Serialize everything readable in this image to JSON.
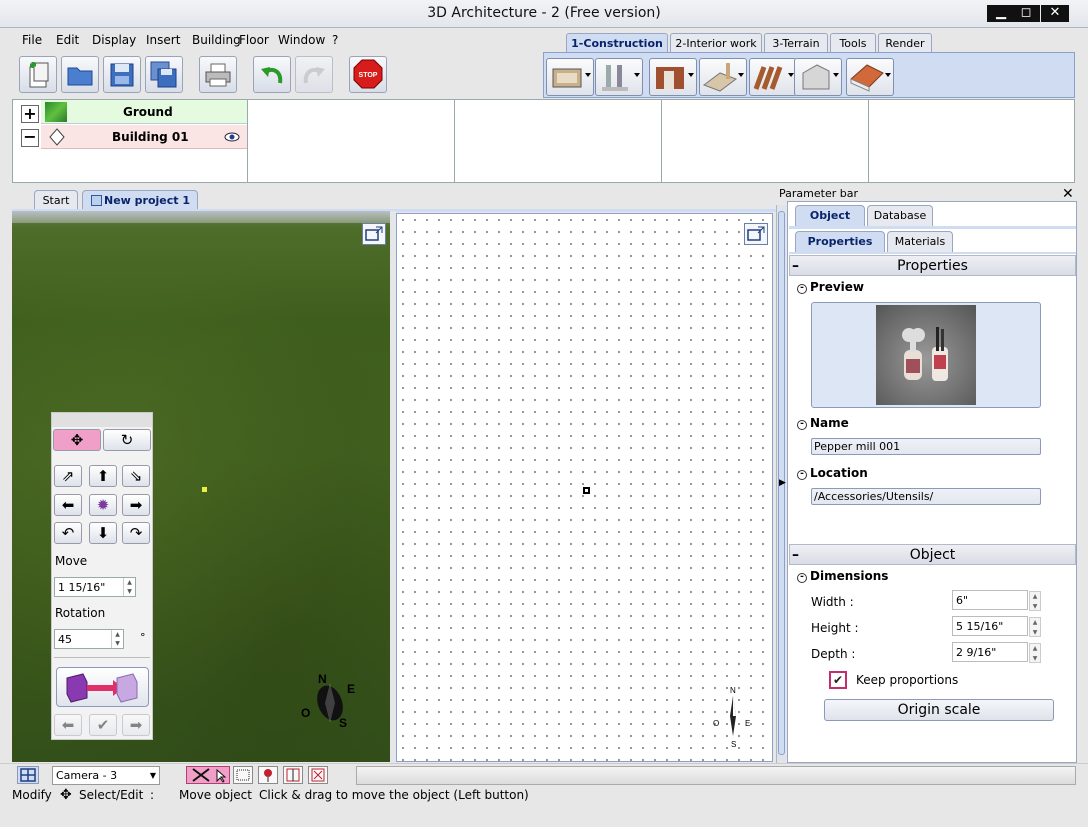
{
  "window": {
    "title": "3D Architecture - 2 (Free version)"
  },
  "menu": [
    "File",
    "Edit",
    "Display",
    "Insert",
    "Building",
    "Floor",
    "Window",
    "?"
  ],
  "toolbar": {
    "stop_label": "STOP"
  },
  "mode_tabs": [
    "1-Construction",
    "2-Interior work",
    "3-Terrain",
    "Tools",
    "Render"
  ],
  "floors": [
    {
      "name": "Ground"
    },
    {
      "name": "Building 01"
    }
  ],
  "doc_tabs": [
    "Start",
    "New project 1"
  ],
  "nav_panel": {
    "move_label": "Move",
    "move_value": "1 15/16\"",
    "rotation_label": "Rotation",
    "rotation_value": "45",
    "rotation_unit": "°"
  },
  "compass_3d": {
    "n": "N",
    "e": "E",
    "o": "O",
    "s": "S"
  },
  "compass_2d": {
    "n": "N",
    "e": "E",
    "o": "O",
    "s": "S"
  },
  "param_bar": {
    "title": "Parameter bar",
    "tabs": [
      "Object",
      "Database"
    ],
    "subtabs": [
      "Properties",
      "Materials"
    ],
    "properties_header": "Properties",
    "preview_label": "Preview",
    "name_label": "Name",
    "name_value": "Pepper mill 001",
    "location_label": "Location",
    "location_value": "/Accessories/Utensils/",
    "object_header": "Object",
    "dimensions_label": "Dimensions",
    "width_label": "Width :",
    "width_value": "6\"",
    "height_label": "Height :",
    "height_value": "5 15/16\"",
    "depth_label": "Depth :",
    "depth_value": "2 9/16\"",
    "keep_proportions_label": "Keep proportions",
    "keep_proportions_checked": true,
    "origin_scale_label": "Origin scale"
  },
  "statusbar": {
    "camera": "Camera - 3",
    "mode": "Modify",
    "tool": "Select/Edit",
    "tool_sep": ":",
    "action": "Move object",
    "hint": "Click & drag to move the object (Left button)"
  },
  "colors": {
    "active_tab_text": "#0a246a",
    "ground_row": "#e4fbdf",
    "building_row": "#fbe4e4",
    "panel_pink": "#f0a0c8"
  }
}
